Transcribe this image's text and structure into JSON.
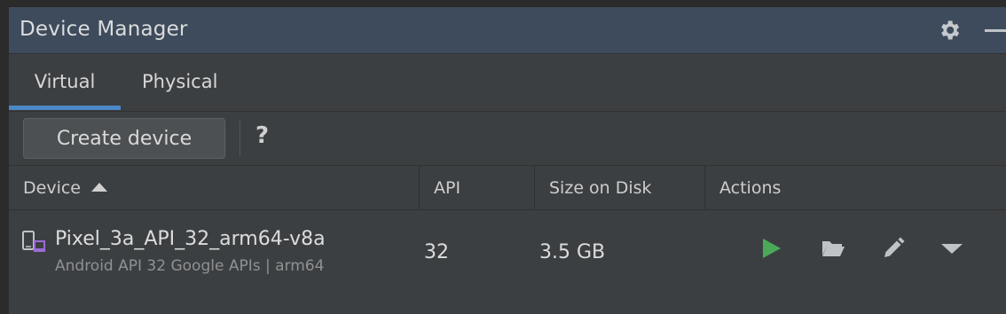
{
  "panel": {
    "title": "Device Manager",
    "settings_icon": "gear-icon",
    "minimize_icon": "minimize-icon"
  },
  "tabs": [
    {
      "label": "Virtual",
      "selected": true
    },
    {
      "label": "Physical",
      "selected": false
    }
  ],
  "toolbar": {
    "create_label": "Create device",
    "help_label": "?"
  },
  "table": {
    "columns": [
      {
        "label": "Device",
        "sorted": "ascending"
      },
      {
        "label": "API"
      },
      {
        "label": "Size on Disk"
      },
      {
        "label": "Actions"
      }
    ],
    "rows": [
      {
        "name": "Pixel_3a_API_32_arm64-v8a",
        "subtitle": "Android API 32 Google APIs | arm64",
        "api": "32",
        "size": "3.5 GB",
        "actions": [
          "run-icon",
          "folder-icon",
          "edit-icon",
          "more-icon"
        ]
      }
    ]
  },
  "colors": {
    "title_bar": "#3d4b5c",
    "tab_accent": "#4a88c7",
    "run_green": "#4aa959"
  }
}
